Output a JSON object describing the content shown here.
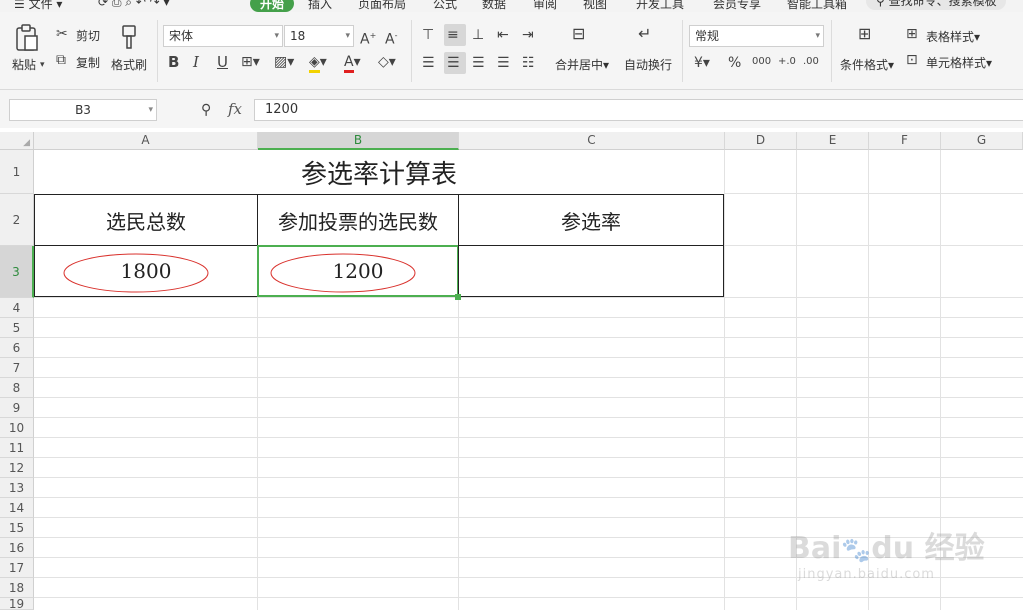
{
  "menu": {
    "file": "文件",
    "tabs": [
      "开始",
      "插入",
      "页面布局",
      "公式",
      "数据",
      "审阅",
      "视图",
      "开发工具",
      "会员专享",
      "智能工具箱"
    ],
    "active_tab": "开始",
    "search_placeholder": "查找命令、搜索模板"
  },
  "ribbon": {
    "paste": "粘贴",
    "cut": "剪切",
    "copy": "复制",
    "format_painter": "格式刷",
    "font_name": "宋体",
    "font_size": "18",
    "merge_center": "合并居中",
    "wrap_text": "自动换行",
    "number_format": "常规",
    "conditional_format": "条件格式",
    "table_style": "表格样式",
    "cell_style": "单元格样式"
  },
  "formula_bar": {
    "name_box": "B3",
    "fx": "fx",
    "value": "1200"
  },
  "columns": [
    "A",
    "B",
    "C",
    "D",
    "E",
    "F",
    "G"
  ],
  "rows": [
    "1",
    "2",
    "3",
    "4",
    "5",
    "6",
    "7",
    "8",
    "9",
    "10",
    "11",
    "12",
    "13",
    "14",
    "15",
    "16",
    "17",
    "18",
    "19"
  ],
  "sheet": {
    "title": "参选率计算表",
    "headers": [
      "选民总数",
      "参加投票的选民数",
      "参选率"
    ],
    "values": [
      "1800",
      "1200",
      ""
    ]
  },
  "colors": {
    "accent": "#4caf50",
    "annotation": "#d9312c"
  },
  "watermark": "Baidu经验 jingyan.baidu.com"
}
